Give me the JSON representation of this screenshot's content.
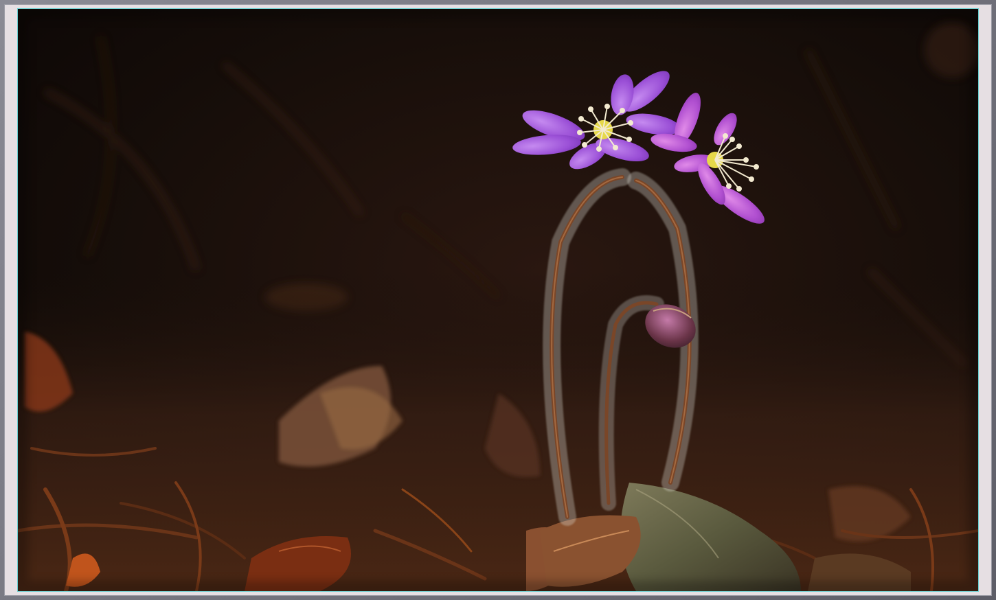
{
  "image": {
    "subject": "purple-hepatica-flowers",
    "colors": {
      "background_dark": "#120b08",
      "soil_brown": "#3a2014",
      "leaf_rust": "#8a3f1a",
      "petal_purple": "#9a4fd6",
      "petal_highlight": "#c58af0",
      "stamen_cream": "#f3ead0",
      "stem_hair": "#d8d4cc",
      "frame_mat": "#e6dfe3",
      "frame_accent": "#6ad0d2"
    }
  }
}
